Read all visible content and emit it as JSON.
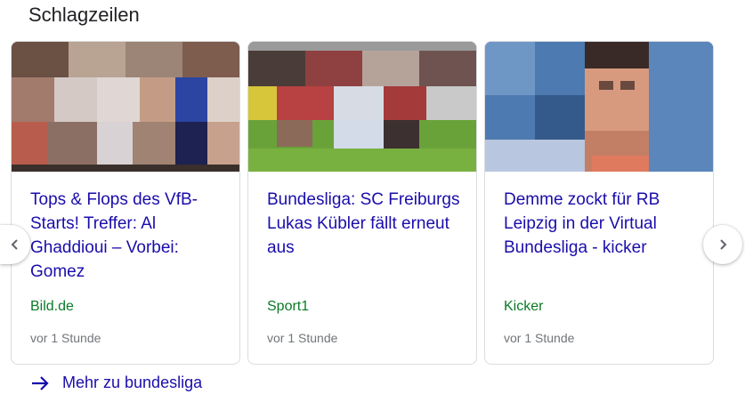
{
  "section": {
    "title": "Schlagzeilen"
  },
  "articles": [
    {
      "headline": "Tops & Flops des VfB-Starts! Treffer: Al Ghaddioui – Vorbei: Gomez",
      "source": "Bild.de",
      "time": "vor 1 Stunde",
      "thumbnail_icon": "football-players-photo-pixelated"
    },
    {
      "headline": "Bundesliga: SC Freiburgs Lukas Kübler fällt erneut aus",
      "source": "Sport1",
      "time": "vor 1 Stunde",
      "thumbnail_icon": "football-match-photo-pixelated"
    },
    {
      "headline": "Demme zockt für RB Leipzig in der Virtual Bundesliga - kicker",
      "source": "Kicker",
      "time": "vor 1 Stunde",
      "thumbnail_icon": "player-portrait-photo-pixelated"
    }
  ],
  "carousel": {
    "prev_icon": "chevron-left-icon",
    "next_icon": "chevron-right-icon"
  },
  "more": {
    "label": "Mehr zu bundesliga",
    "icon": "arrow-right-icon"
  },
  "colors": {
    "link": "#1a0dab",
    "source": "#0b7a26",
    "meta": "#70757a",
    "border": "#dadce0"
  }
}
